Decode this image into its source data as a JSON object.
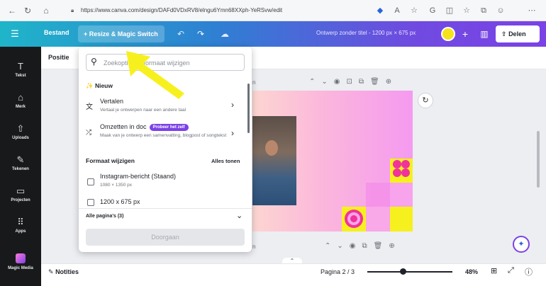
{
  "browser": {
    "url": "https://www.canva.com/design/DAFd0VDxRV8/elngu6Ymn68XXph-YeRSvw/edit"
  },
  "header": {
    "menu_label": "Bestand",
    "resize_label": "+ Resize & Magic Switch",
    "title": "Ontwerp zonder titel - 1200 px × 675 px",
    "share_label": "Delen"
  },
  "sidebar": {
    "items": [
      {
        "label": "Tekst",
        "icon": "text-icon"
      },
      {
        "label": "Merk",
        "icon": "brand-icon"
      },
      {
        "label": "Uploads",
        "icon": "upload-icon"
      },
      {
        "label": "Tekenen",
        "icon": "draw-icon"
      },
      {
        "label": "Projecten",
        "icon": "folder-icon"
      },
      {
        "label": "Apps",
        "icon": "apps-icon"
      },
      {
        "label": "Magic Media",
        "icon": "magic-media-icon"
      }
    ]
  },
  "toolbar": {
    "positie_label": "Positie"
  },
  "panel": {
    "search_placeholder": "Zoekopties of formaat wijzigen",
    "new_section": "✨ Nieuw",
    "items": [
      {
        "title": "Vertalen",
        "desc": "Vertaal je ontwerpen naar een andere taal"
      },
      {
        "title": "Omzetten in doc",
        "badge": "Probeer het zelf",
        "desc": "Maak van je ontwerp een samenvatting, blogpost of songtekst"
      }
    ],
    "format_section": "Formaat wijzigen",
    "show_all": "Alles tonen",
    "formats": [
      {
        "title": "Instagram-bericht (Staand)",
        "size": "1080 × 1350 px",
        "checked": false
      },
      {
        "title": "1200 x 675 px",
        "checked": false
      }
    ],
    "pages_select": "Alle pagina's (3)",
    "continue_label": "Doorgaan"
  },
  "footer": {
    "notes_label": "Notities",
    "page_indicator": "Pagina 2 / 3",
    "zoom": "48%",
    "zoom_fraction": 0.48
  },
  "colors": {
    "header_start": "#1fb5c9",
    "header_end": "#7b42e6",
    "accent_purple": "#7b42e6",
    "arrow_yellow": "#f7f01f",
    "sidebar_bg": "#18191b"
  }
}
